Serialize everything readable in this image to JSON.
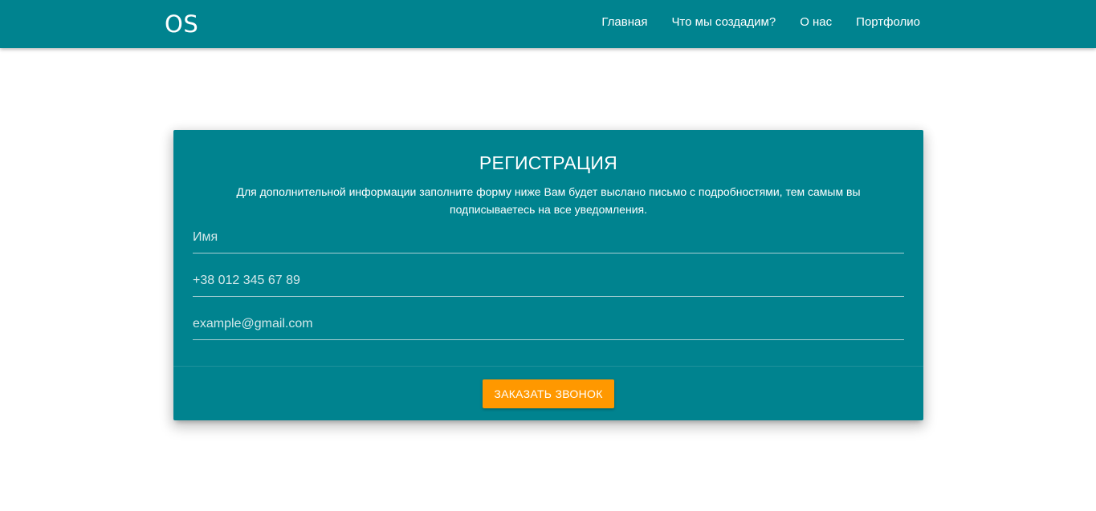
{
  "navbar": {
    "brand": "OS",
    "links": [
      {
        "label": "Главная"
      },
      {
        "label": "Что мы создадим?"
      },
      {
        "label": "О нас"
      },
      {
        "label": "Портфолио"
      }
    ]
  },
  "form": {
    "title": "РЕГИСТРАЦИЯ",
    "description": "Для дополнительной информации заполните форму ниже Вам будет выслано письмо с подробностями, тем самым вы подписываетесь на все уведомления.",
    "fields": {
      "name": {
        "placeholder": "Имя",
        "value": ""
      },
      "phone": {
        "placeholder": "+38 012 345 67 89",
        "value": ""
      },
      "email": {
        "placeholder": "example@gmail.com",
        "value": ""
      }
    },
    "submit_label": "Заказать звонок"
  },
  "colors": {
    "primary": "#00838f",
    "accent": "#ff9800",
    "text_light": "#ffffff"
  }
}
